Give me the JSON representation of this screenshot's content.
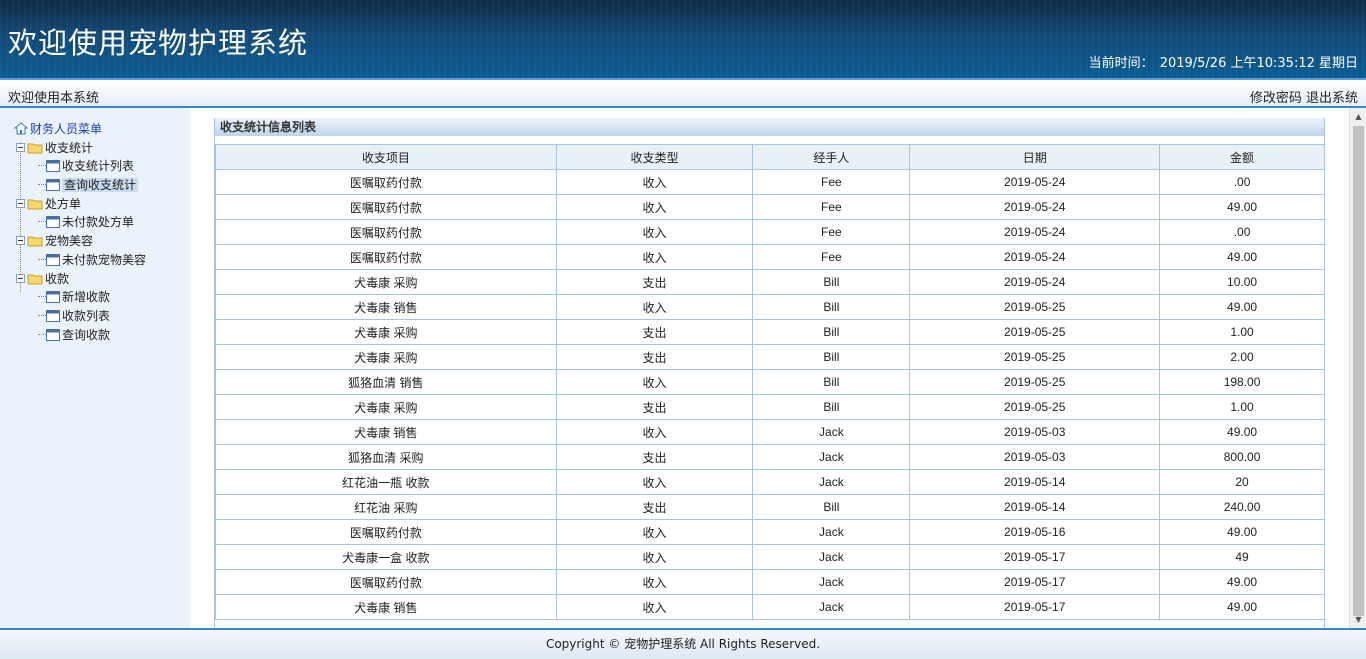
{
  "header": {
    "title": "欢迎使用宠物护理系统",
    "time_label": "当前时间：",
    "time_value": "2019/5/26 上午10:35:12 星期日"
  },
  "subbar": {
    "welcome": "欢迎使用本系统",
    "change_password": "修改密码",
    "logout": "退出系统"
  },
  "menu": {
    "root": "财务人员菜单",
    "groups": [
      {
        "label": "收支统计",
        "items": [
          "收支统计列表",
          "查询收支统计"
        ]
      },
      {
        "label": "处方单",
        "items": [
          "未付款处方单"
        ]
      },
      {
        "label": "宠物美容",
        "items": [
          "未付款宠物美容"
        ]
      },
      {
        "label": "收款",
        "items": [
          "新增收款",
          "收款列表",
          "查询收款"
        ]
      }
    ]
  },
  "panel": {
    "title": "收支统计信息列表",
    "columns": [
      "收支项目",
      "收支类型",
      "经手人",
      "日期",
      "金额"
    ],
    "rows": [
      [
        "医嘱取药付款",
        "收入",
        "Fee",
        "2019-05-24",
        ".00"
      ],
      [
        "医嘱取药付款",
        "收入",
        "Fee",
        "2019-05-24",
        "49.00"
      ],
      [
        "医嘱取药付款",
        "收入",
        "Fee",
        "2019-05-24",
        ".00"
      ],
      [
        "医嘱取药付款",
        "收入",
        "Fee",
        "2019-05-24",
        "49.00"
      ],
      [
        "犬毒康 采购",
        "支出",
        "Bill",
        "2019-05-24",
        "10.00"
      ],
      [
        "犬毒康 销售",
        "收入",
        "Bill",
        "2019-05-25",
        "49.00"
      ],
      [
        "犬毒康 采购",
        "支出",
        "Bill",
        "2019-05-25",
        "1.00"
      ],
      [
        "犬毒康 采购",
        "支出",
        "Bill",
        "2019-05-25",
        "2.00"
      ],
      [
        "狐狢血清 销售",
        "收入",
        "Bill",
        "2019-05-25",
        "198.00"
      ],
      [
        "犬毒康 采购",
        "支出",
        "Bill",
        "2019-05-25",
        "1.00"
      ],
      [
        "犬毒康 销售",
        "收入",
        "Jack",
        "2019-05-03",
        "49.00"
      ],
      [
        "狐狢血清 采购",
        "支出",
        "Jack",
        "2019-05-03",
        "800.00"
      ],
      [
        "红花油一瓶 收款",
        "收入",
        "Jack",
        "2019-05-14",
        "20"
      ],
      [
        "红花油 采购",
        "支出",
        "Bill",
        "2019-05-14",
        "240.00"
      ],
      [
        "医嘱取药付款",
        "收入",
        "Jack",
        "2019-05-16",
        "49.00"
      ],
      [
        "犬毒康一盒 收款",
        "收入",
        "Jack",
        "2019-05-17",
        "49"
      ],
      [
        "医嘱取药付款",
        "收入",
        "Jack",
        "2019-05-17",
        "49.00"
      ],
      [
        "犬毒康 销售",
        "收入",
        "Jack",
        "2019-05-17",
        "49.00"
      ]
    ]
  },
  "footer": {
    "copyright": "Copyright © 宠物护理系统 All Rights Reserved."
  }
}
